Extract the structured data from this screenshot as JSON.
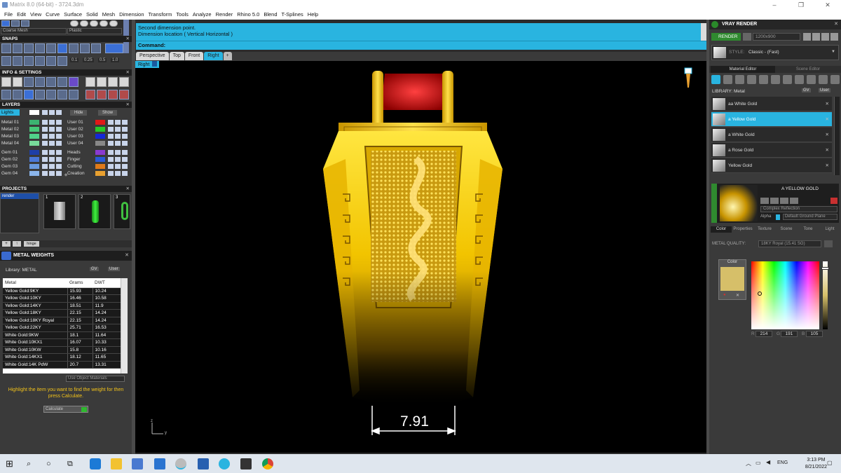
{
  "window": {
    "title": "Matrix 8.0 (64-bit) - 3724.3dm",
    "controls": [
      "–",
      "❐",
      "✕"
    ]
  },
  "menu": [
    "File",
    "Edit",
    "View",
    "Curve",
    "Surface",
    "Solid",
    "Mesh",
    "Dimension",
    "Transform",
    "Tools",
    "Analyze",
    "Render",
    "Rhino 5.0",
    "Blend",
    "T-Splines",
    "Help"
  ],
  "left": {
    "mesh_combo": "Coarse Mesh",
    "material_combo": "Plastic",
    "snaps_title": "SNAPS",
    "snap_values": [
      "0.1",
      "0.25",
      "0.5",
      "1.0"
    ],
    "info_title": "INFO & SETTINGS",
    "layers_title": "LAYERS",
    "lights_label": "Lights",
    "hide_label": "Hide",
    "show_label": "Show",
    "layers_left": [
      {
        "name": "Metal 01",
        "color": "#3cb371"
      },
      {
        "name": "Metal 02",
        "color": "#46c878"
      },
      {
        "name": "Metal 03",
        "color": "#50d28a"
      },
      {
        "name": "Metal 04",
        "color": "#78dc9a"
      },
      {
        "name": "Gem 01",
        "color": "#1e3fa8"
      },
      {
        "name": "Gem 02",
        "color": "#4a78d8"
      },
      {
        "name": "Gem 03",
        "color": "#6a9ae0"
      },
      {
        "name": "Gem 04",
        "color": "#8ab4ea"
      }
    ],
    "layers_right": [
      {
        "name": "User 01",
        "color": "#e01818"
      },
      {
        "name": "User 02",
        "color": "#28c828"
      },
      {
        "name": "User 03",
        "color": "#1428d8"
      },
      {
        "name": "User 04",
        "color": "#888888"
      },
      {
        "name": "Heads",
        "color": "#8a3ad0"
      },
      {
        "name": "Finger",
        "color": "#2a5ad8"
      },
      {
        "name": "Cutting",
        "color": "#e07a18"
      },
      {
        "name": "Creation",
        "color": "#e8a030"
      }
    ],
    "projects_title": "PROJECTS",
    "projects_item": "render",
    "project_nums": [
      "1",
      "2",
      "3"
    ],
    "hinge_label": "hinge",
    "metal_weights_title": "METAL WEIGHTS",
    "library_label": "Library:  METAL",
    "gv_label": "GV",
    "user_label": "User",
    "table_headers": [
      "Metal",
      "Grams",
      "DWT"
    ],
    "table_rows": [
      [
        "Yellow Gold:9KY",
        "15.93",
        "10.24"
      ],
      [
        "Yellow Gold:10KY",
        "16.46",
        "10.58"
      ],
      [
        "Yellow Gold:14KY",
        "18.51",
        "11.9"
      ],
      [
        "Yellow Gold:18KY",
        "22.15",
        "14.24"
      ],
      [
        "Yellow Gold:18KY Royal",
        "22.15",
        "14.24"
      ],
      [
        "Yellow Gold:22KY",
        "25.71",
        "16.53"
      ],
      [
        "White Gold:9KW",
        "18.1",
        "11.64"
      ],
      [
        "White Gold:10KX1",
        "16.07",
        "10.33"
      ],
      [
        "White Gold:10KW",
        "15.8",
        "10.16"
      ],
      [
        "White Gold:14KX1",
        "18.12",
        "11.65"
      ],
      [
        "White Gold:14K PdW",
        "20.7",
        "13.31"
      ]
    ],
    "use_object_materials": "Use Object Materials",
    "hint": "Highlight the item you want to find the weight for then press Calculate.",
    "calculate_label": "Calculate"
  },
  "command": {
    "line1": "Second dimension point.",
    "line2": "Dimension location ( Vertical  Horizontal )",
    "prompt": "Command:",
    "value": ""
  },
  "viewport": {
    "tabs": [
      "Perspective",
      "Top",
      "Front",
      "Right"
    ],
    "active_tab": "Right",
    "label": "Right",
    "dimension": "7.91",
    "axis_z": "z",
    "axis_y": "y"
  },
  "right": {
    "vray_title": "VRAY RENDER",
    "render_btn": "RENDER",
    "resolution": "1200x900",
    "style_label": "STYLE:",
    "style_value": "Classic - (Fast)",
    "tab_material": "Material Editor",
    "tab_scene": "Scene Editor",
    "library_label": "LIBRARY:  Metal",
    "gv_label": "GV",
    "user_label": "User",
    "materials": [
      "aa White Gold",
      "a Yellow Gold",
      "a White Gold",
      "a Rose Gold",
      "Yellow Gold"
    ],
    "selected_material_index": 1,
    "selected_name": "A YELLOW GOLD",
    "reflection": "Complex Reflection",
    "alpha_label": "Alpha",
    "ground_plane": "Default Ground Plane",
    "sub_tabs": [
      "Color",
      "Properties",
      "Texture",
      "Scene",
      "Tone",
      "Light"
    ],
    "metal_quality_label": "METAL QUALITY:",
    "metal_quality_value": "18KY Royal   (15.41 SG)",
    "color_label": "Color",
    "swatch_color": "#d6bf69",
    "rgb": {
      "r": "214",
      "g": "191",
      "b": "105"
    },
    "rgb_letters": [
      "R",
      "G",
      "B"
    ]
  },
  "taskbar": {
    "lang": "ENG",
    "time": "3:13 PM",
    "date": "8/21/2022"
  }
}
